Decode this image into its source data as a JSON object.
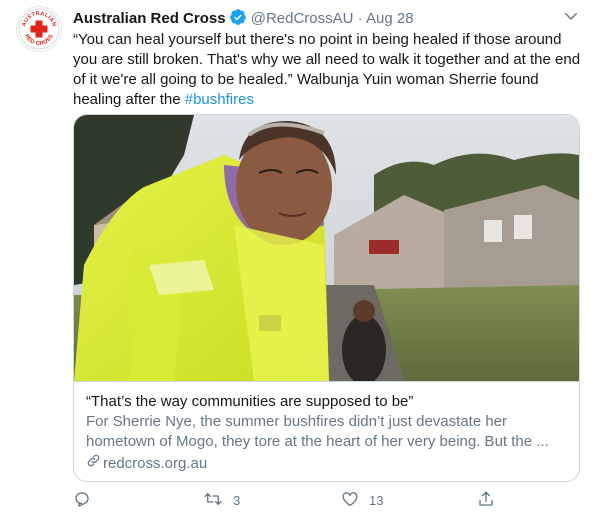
{
  "tweet": {
    "display_name": "Australian Red Cross",
    "handle": "@RedCrossAU",
    "separator": "·",
    "date": "Aug 28",
    "text_before": "“You can heal yourself but there's no point in being healed if those around you are still broken. That's why we all need to walk it together and at the end of it we're all going to be healed.” Walbunja Yuin woman Sherrie found healing after the ",
    "hashtag": "#bushfires"
  },
  "avatar": {
    "logo_text_top": "AUSTRALIAN",
    "logo_text_bottom": "RED CROSS"
  },
  "card": {
    "title": "“That’s the way communities are supposed to be”",
    "description": "For Sherrie Nye, the summer bushfires didn’t just devastate her hometown of Mogo, they tore at the heart of her very being. But the ...",
    "url": "redcross.org.au"
  },
  "actions": {
    "retweets": "3",
    "likes": "13"
  },
  "icons": [
    "verified-badge-icon",
    "chevron-down-icon",
    "link-icon",
    "reply-icon",
    "retweet-icon",
    "like-icon",
    "share-icon"
  ],
  "colors": {
    "link": "#1b95e0",
    "verified": "#1da1f2",
    "red_cross": "#e2231a",
    "muted": "#657786"
  }
}
